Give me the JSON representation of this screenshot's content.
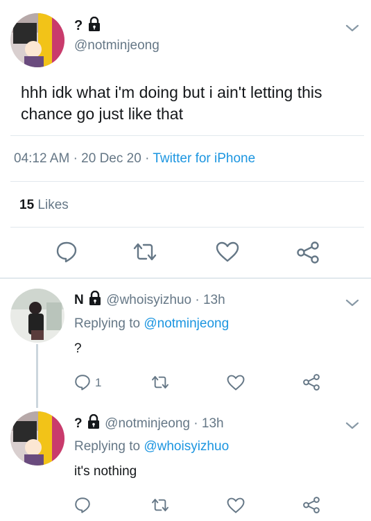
{
  "main_tweet": {
    "display_name": "?",
    "handle": "@notminjeong",
    "text_line1": "hhh idk what i'm doing but i ain't letting this",
    "text_line2": "chance go just like that",
    "time": "04:12 AM",
    "date": "20 Dec 20",
    "source": "Twitter for iPhone",
    "likes_count": "15",
    "likes_label": "Likes"
  },
  "replies": [
    {
      "display_name": "N",
      "handle": "@whoisyizhuo",
      "age": "13h",
      "replying_prefix": "Replying to",
      "replying_to": "@notminjeong",
      "text": "?",
      "reply_count": "1"
    },
    {
      "display_name": "?",
      "handle": "@notminjeong",
      "age": "13h",
      "replying_prefix": "Replying to",
      "replying_to": "@whoisyizhuo",
      "text": "it's nothing",
      "reply_count": ""
    }
  ],
  "colors": {
    "link": "#1b95e0",
    "muted": "#657786",
    "divider": "#e1e8ed"
  },
  "icons": [
    "lock-icon",
    "chevron-down-icon",
    "reply-icon",
    "retweet-icon",
    "like-icon",
    "share-icon"
  ]
}
